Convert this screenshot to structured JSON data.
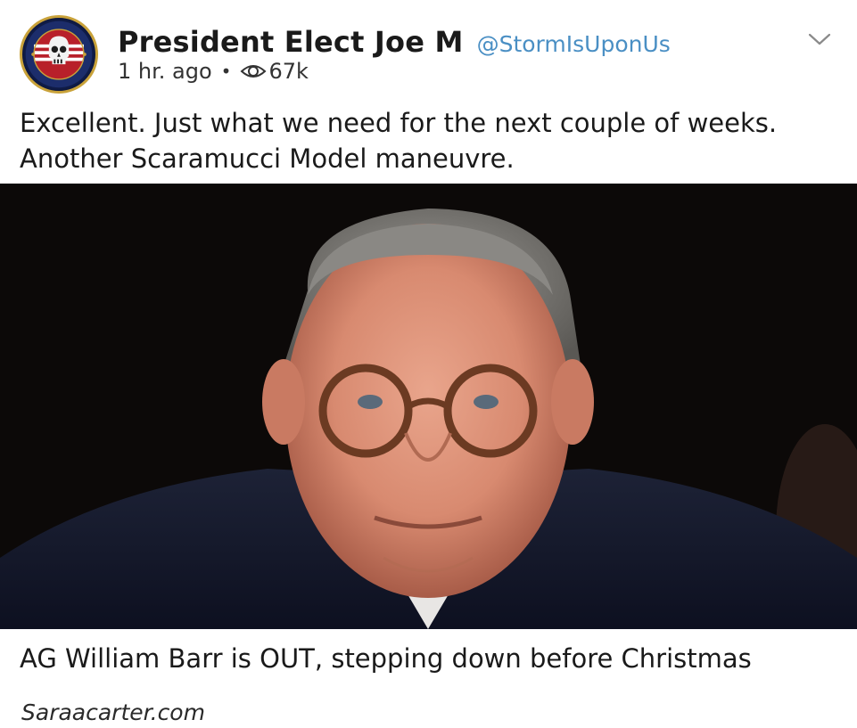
{
  "post": {
    "author": {
      "display_name": "President Elect Joe M",
      "handle": "@StormIsUponUs",
      "avatar_icon": "skull-patriot-badge-icon"
    },
    "meta": {
      "time": "1 hr. ago",
      "separator": "•",
      "views": "67k",
      "views_icon": "eye-icon"
    },
    "menu_icon": "chevron-down-icon",
    "text": "Excellent. Just what we need for the next couple of weeks. Another Scaramucci Model maneuvre."
  },
  "link_card": {
    "image_icon": "news-photo",
    "title": "AG William Barr is OUT, stepping down before Christmas",
    "domain": "Saraacarter.com"
  },
  "colors": {
    "handle": "#4a8fc4",
    "text": "#1a1a1a",
    "badge_gold": "#c9a23a",
    "badge_blue": "#1c2d6b"
  }
}
